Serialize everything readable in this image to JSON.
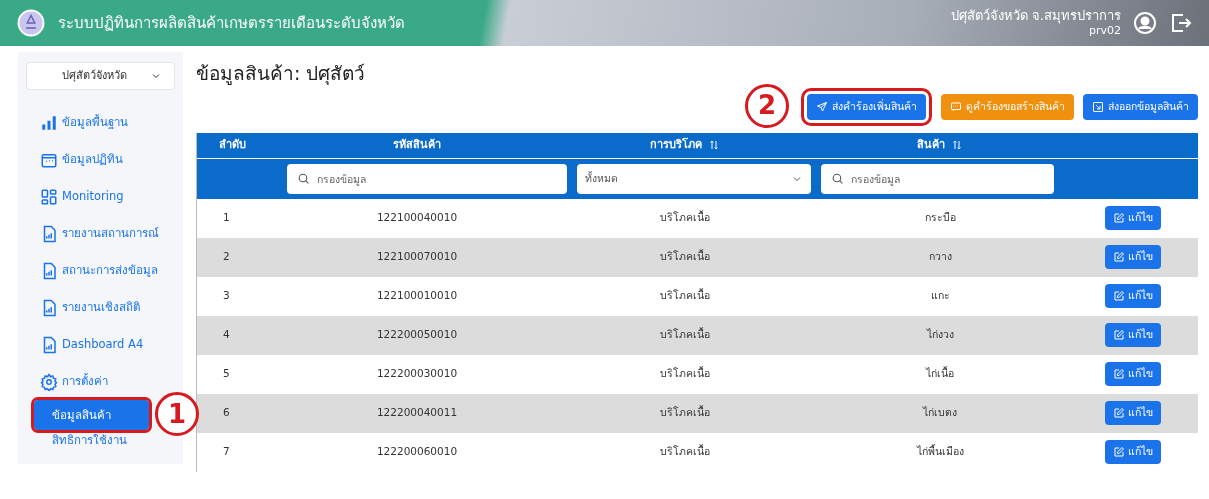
{
  "header": {
    "title": "ระบบปฏิทินการผลิตสินค้าเกษตรรายเดือนระดับจังหวัด",
    "user_name": "ปศุสัตว์จังหวัด จ.สมุทรปราการ",
    "user_id": "prv02"
  },
  "sidebar": {
    "dropdown": "ปศุสัตว์จังหวัด",
    "items": [
      {
        "kind": "bars",
        "label": "ข้อมูลพื้นฐาน",
        "selected": false
      },
      {
        "kind": "calendar",
        "label": "ข้อมูลปฏิทิน",
        "selected": false
      },
      {
        "kind": "grid",
        "label": "Monitoring",
        "selected": false
      },
      {
        "kind": "report",
        "label": "รายงานสถานการณ์",
        "selected": false
      },
      {
        "kind": "report",
        "label": "สถานะการส่งข้อมูล",
        "selected": false
      },
      {
        "kind": "report",
        "label": "รายงานเชิงสถิติ",
        "selected": false
      },
      {
        "kind": "report",
        "label": "Dashboard A4",
        "selected": false
      },
      {
        "kind": "gear",
        "label": "การตั้งค่า",
        "selected": false,
        "children": [
          {
            "label": "ข้อมูลสินค้า",
            "selected": true,
            "callout": "1"
          },
          {
            "label": "สิทธิการใช้งาน",
            "selected": false
          }
        ]
      }
    ]
  },
  "page": {
    "title": "ข้อมูลสินค้า: ปศุสัตว์",
    "buttons": [
      {
        "kind": "send",
        "label": "ส่งคำร้องเพิ่มสินค้า",
        "color": "#1a73e8",
        "callout": "2"
      },
      {
        "kind": "message",
        "label": "ดูคำร้องขอสร้างสินค้า",
        "color": "#f0900f"
      },
      {
        "kind": "export",
        "label": "ส่งออกข้อมูลสินค้า",
        "color": "#1a73e8"
      }
    ]
  },
  "table": {
    "columns": [
      {
        "label": "ลำดับ",
        "sortable": false
      },
      {
        "label": "รหัสสินค้า",
        "sortable": false
      },
      {
        "label": "การบริโภค",
        "sortable": true
      },
      {
        "label": "สินค้า",
        "sortable": true
      }
    ],
    "filters": {
      "code_placeholder": "กรองข้อมูล",
      "consumption_value": "ทั้งหมด",
      "product_placeholder": "กรองข้อมูล"
    },
    "rows": [
      {
        "no": "1",
        "code": "122100040010",
        "consumption": "บริโภคเนื้อ",
        "product": "กระบือ",
        "action": "แก้ไข"
      },
      {
        "no": "2",
        "code": "122100070010",
        "consumption": "บริโภคเนื้อ",
        "product": "กวาง",
        "action": "แก้ไข"
      },
      {
        "no": "3",
        "code": "122100010010",
        "consumption": "บริโภคเนื้อ",
        "product": "แกะ",
        "action": "แก้ไข"
      },
      {
        "no": "4",
        "code": "122200050010",
        "consumption": "บริโภคเนื้อ",
        "product": "ไก่งวง",
        "action": "แก้ไข"
      },
      {
        "no": "5",
        "code": "122200030010",
        "consumption": "บริโภคเนื้อ",
        "product": "ไก่เนื้อ",
        "action": "แก้ไข"
      },
      {
        "no": "6",
        "code": "122200040011",
        "consumption": "บริโภคเนื้อ",
        "product": "ไก่เบตง",
        "action": "แก้ไข"
      },
      {
        "no": "7",
        "code": "122200060010",
        "consumption": "บริโภคเนื้อ",
        "product": "ไก่พื้นเมือง",
        "action": "แก้ไข"
      }
    ]
  }
}
